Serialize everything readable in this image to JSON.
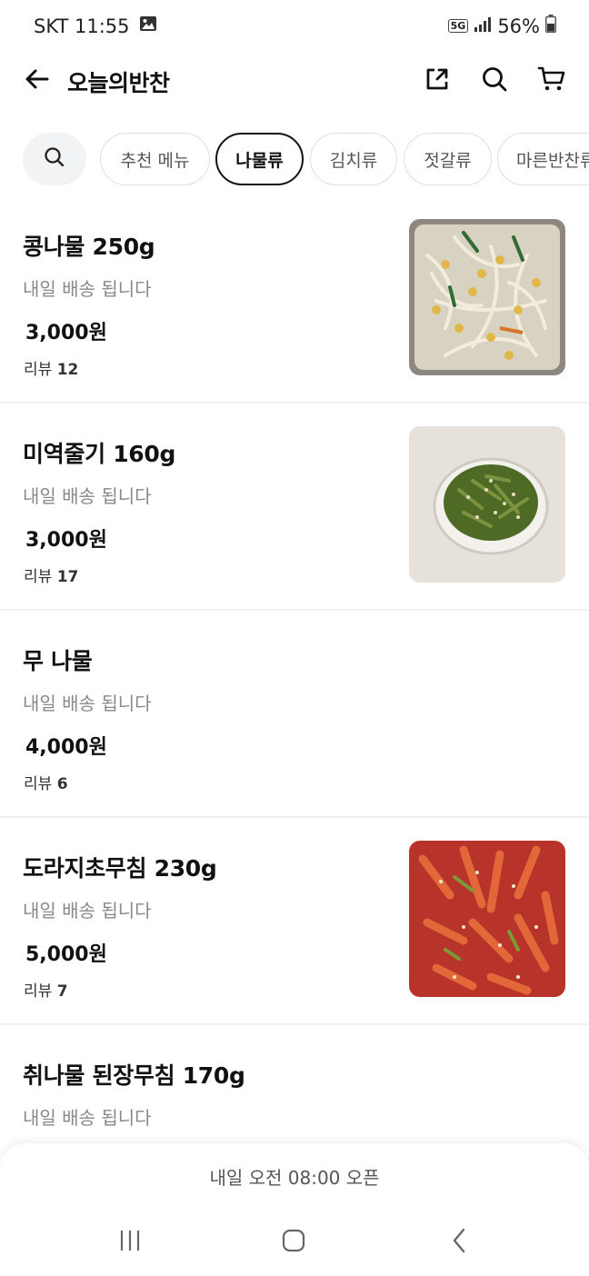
{
  "status": {
    "carrier_time": "SKT 11:55",
    "network": "5G",
    "battery": "56%"
  },
  "appbar": {
    "title": "오늘의반찬"
  },
  "chips": [
    "추천 메뉴",
    "나물류",
    "김치류",
    "젓갈류",
    "마른반찬류"
  ],
  "active_chip": "나물류",
  "items": [
    {
      "name": "콩나물 250g",
      "delivery": "내일 배송 됩니다",
      "price": "3,000원",
      "review_label": "리뷰",
      "review_count": "12"
    },
    {
      "name": "미역줄기 160g",
      "delivery": "내일 배송 됩니다",
      "price": "3,000원",
      "review_label": "리뷰",
      "review_count": "17"
    },
    {
      "name": "무 나물",
      "delivery": "내일 배송 됩니다",
      "price": "4,000원",
      "review_label": "리뷰",
      "review_count": "6"
    },
    {
      "name": "도라지초무침 230g",
      "delivery": "내일 배송 됩니다",
      "price": "5,000원",
      "review_label": "리뷰",
      "review_count": "7"
    },
    {
      "name": "취나물 된장무침 170g",
      "delivery": "내일 배송 됩니다"
    }
  ],
  "bottom": {
    "open_text": "내일 오전 08:00 오픈"
  },
  "colors": {
    "accent": "#111111",
    "muted_text": "#888888",
    "chip_border": "#dcdfe3",
    "search_chip_bg": "#f1f3f5"
  },
  "icons": [
    "back-arrow-icon",
    "share-icon",
    "search-icon",
    "cart-icon",
    "gallery-icon",
    "signal-icon",
    "battery-icon",
    "recent-apps-icon",
    "home-icon",
    "nav-back-icon"
  ]
}
